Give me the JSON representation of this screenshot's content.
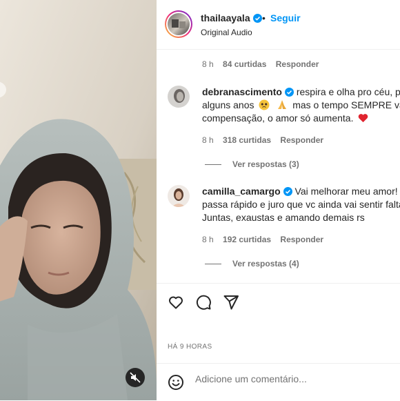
{
  "post": {
    "username": "thailaayala",
    "separator": "•",
    "follow_label": "Seguir",
    "audio": "Original Audio"
  },
  "first_comment_meta": {
    "age": "8 h",
    "likes": "84 curtidas",
    "reply": "Responder"
  },
  "comments": [
    {
      "username": "debranascimento",
      "lines": [
        "respira e olha pro céu, pq",
        "alguns anos",
        "mas o tempo SEMPRE vai s",
        "compensação, o amor só aumenta."
      ],
      "age": "8 h",
      "likes": "318 curtidas",
      "reply": "Responder",
      "view_replies": "Ver respostas (3)"
    },
    {
      "username": "camilla_camargo",
      "lines": [
        "Vai melhorar meu amor! Fo",
        "passa rápido e juro que vc ainda vai sentir falta",
        "Juntas, exaustas e amando demais rs"
      ],
      "age": "8 h",
      "likes": "192 curtidas",
      "reply": "Responder",
      "view_replies": "Ver respostas (4)"
    }
  ],
  "timestamp": "HÁ 9 HORAS",
  "comment_box": {
    "placeholder": "Adicione um comentário..."
  },
  "colors": {
    "accent": "#0095f6",
    "text": "#262626",
    "muted": "#737373",
    "heart": "#ed4956"
  }
}
